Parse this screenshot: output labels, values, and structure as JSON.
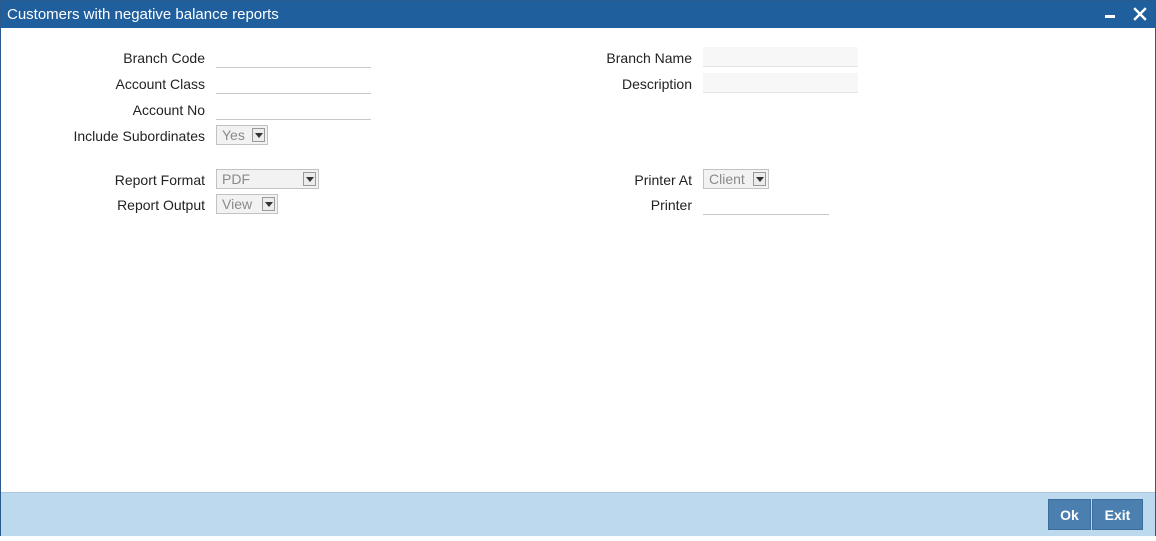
{
  "window": {
    "title": "Customers with negative balance reports"
  },
  "form": {
    "branch_code": {
      "label": "Branch Code",
      "value": ""
    },
    "account_class": {
      "label": "Account Class",
      "value": ""
    },
    "account_no": {
      "label": "Account No",
      "value": ""
    },
    "include_subordinates": {
      "label": "Include Subordinates",
      "value": "Yes"
    },
    "branch_name": {
      "label": "Branch Name",
      "value": ""
    },
    "description": {
      "label": "Description",
      "value": ""
    },
    "report_format": {
      "label": "Report Format",
      "value": "PDF"
    },
    "report_output": {
      "label": "Report Output",
      "value": "View"
    },
    "printer_at": {
      "label": "Printer At",
      "value": "Client"
    },
    "printer": {
      "label": "Printer",
      "value": ""
    }
  },
  "footer": {
    "ok_label": "Ok",
    "exit_label": "Exit"
  }
}
